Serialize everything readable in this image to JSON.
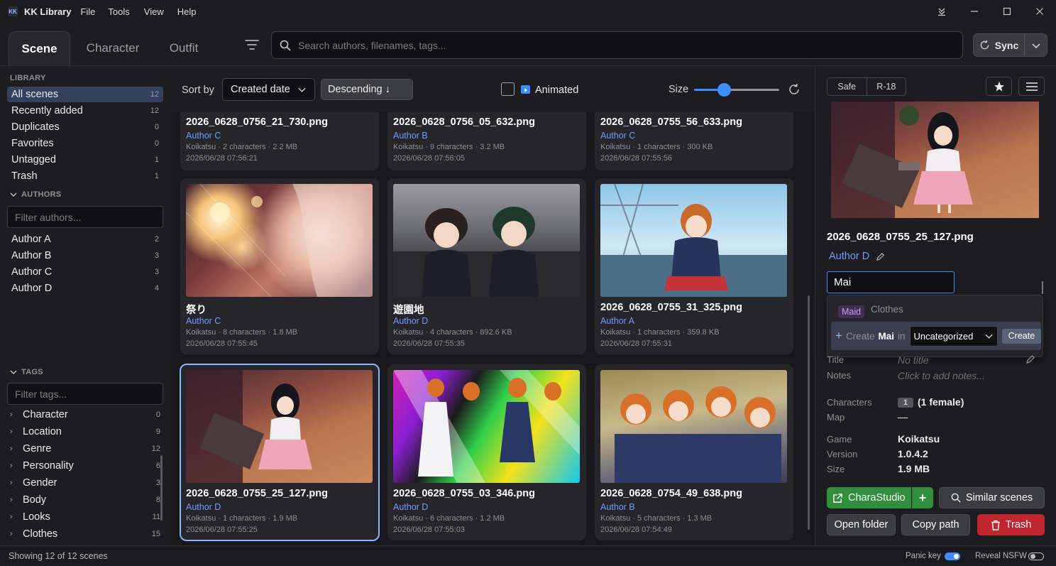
{
  "app": {
    "name": "KK Library",
    "menu": [
      "File",
      "Tools",
      "View",
      "Help"
    ]
  },
  "tabs": [
    {
      "label": "Scene"
    },
    {
      "label": "Character"
    },
    {
      "label": "Outfit"
    }
  ],
  "search": {
    "placeholder": "Search authors, filenames, tags..."
  },
  "sync": {
    "label": "Sync"
  },
  "sidebar": {
    "library_header": "LIBRARY",
    "library": [
      {
        "label": "All scenes",
        "count": "12"
      },
      {
        "label": "Recently added",
        "count": "12"
      },
      {
        "label": "Duplicates",
        "count": "0"
      },
      {
        "label": "Favorites",
        "count": "0"
      },
      {
        "label": "Untagged",
        "count": "1"
      },
      {
        "label": "Trash",
        "count": "1"
      }
    ],
    "authors_header": "AUTHORS",
    "authors_filter_placeholder": "Filter authors...",
    "authors": [
      {
        "label": "Author A",
        "count": "2"
      },
      {
        "label": "Author B",
        "count": "3"
      },
      {
        "label": "Author C",
        "count": "3"
      },
      {
        "label": "Author D",
        "count": "4"
      }
    ],
    "tags_header": "TAGS",
    "tags_filter_placeholder": "Filter tags...",
    "tags": [
      {
        "label": "Character",
        "count": "0"
      },
      {
        "label": "Location",
        "count": "9"
      },
      {
        "label": "Genre",
        "count": "12"
      },
      {
        "label": "Personality",
        "count": "6"
      },
      {
        "label": "Gender",
        "count": "3"
      },
      {
        "label": "Body",
        "count": "8"
      },
      {
        "label": "Looks",
        "count": "11"
      },
      {
        "label": "Clothes",
        "count": "15"
      }
    ]
  },
  "toolbar": {
    "sort_by": "Sort by",
    "sort_field": "Created date",
    "sort_order": "Descending ↓",
    "animated": "Animated",
    "size_label": "Size",
    "size_level": 0.35
  },
  "scenes": [
    {
      "file": "2026_0628_0756_21_730.png",
      "author": "Author C",
      "meta": "Koikatsu · 2 characters · 2.2 MB",
      "date": "2026/06/28 07:56:21"
    },
    {
      "file": "2026_0628_0756_05_632.png",
      "author": "Author B",
      "meta": "Koikatsu · 9 characters · 3.2 MB",
      "date": "2026/06/28 07:56:05"
    },
    {
      "file": "2026_0628_0755_56_633.png",
      "author": "Author C",
      "meta": "Koikatsu · 1 characters · 300 KB",
      "date": "2026/06/28 07:55:56"
    },
    {
      "file": "祭り",
      "author": "Author C",
      "meta": "Koikatsu · 8 characters · 1.8 MB",
      "date": "2026/06/28 07:55:45"
    },
    {
      "file": "遊園地",
      "author": "Author D",
      "meta": "Koikatsu · 4 characters · 892.6 KB",
      "date": "2026/06/28 07:55:35"
    },
    {
      "file": "2026_0628_0755_31_325.png",
      "author": "Author A",
      "meta": "Koikatsu · 1 characters · 359.8 KB",
      "date": "2026/06/28 07:55:31"
    },
    {
      "file": "2026_0628_0755_25_127.png",
      "author": "Author D",
      "meta": "Koikatsu · 1 characters · 1.9 MB",
      "date": "2026/06/28 07:55:25"
    },
    {
      "file": "2026_0628_0755_03_346.png",
      "author": "Author D",
      "meta": "Koikatsu · 6 characters · 1.2 MB",
      "date": "2026/06/28 07:55:03"
    },
    {
      "file": "2026_0628_0754_49_638.png",
      "author": "Author B",
      "meta": "Koikatsu · 5 characters · 1.3 MB",
      "date": "2026/06/28 07:54:49"
    }
  ],
  "detail": {
    "rating": [
      "Safe",
      "R-18"
    ],
    "title": "2026_0628_0755_25_127.png",
    "author": "Author D",
    "tag_input": "Mai",
    "suggestion": {
      "tag": "Maid",
      "category": "Clothes"
    },
    "create": {
      "prefix": "Create",
      "name": "Mai",
      "in": "in",
      "category": "Uncategorized",
      "button": "Create"
    },
    "fields": {
      "title_label": "Title",
      "title_value": "No title",
      "notes_label": "Notes",
      "notes_value": "Click to add notes...",
      "characters_label": "Characters",
      "characters_count": "1",
      "characters_value": "(1 female)",
      "map_label": "Map",
      "map_value": "—",
      "game_label": "Game",
      "game_value": "Koikatsu",
      "version_label": "Version",
      "version_value": "1.0.4.2",
      "size_label": "Size",
      "size_value": "1.9 MB"
    },
    "buttons": {
      "studio": "CharaStudio",
      "similar": "Similar scenes",
      "open_folder": "Open folder",
      "copy_path": "Copy path",
      "trash": "Trash"
    }
  },
  "status": {
    "text": "Showing 12 of 12 scenes",
    "panic": "Panic key",
    "panic_on": true,
    "nsfw": "Reveal NSFW",
    "nsfw_on": false
  },
  "colors": {
    "accent": "#3d8dff",
    "link": "#6e9cff",
    "studio": "#2f8f3c",
    "trash": "#c0262e"
  }
}
